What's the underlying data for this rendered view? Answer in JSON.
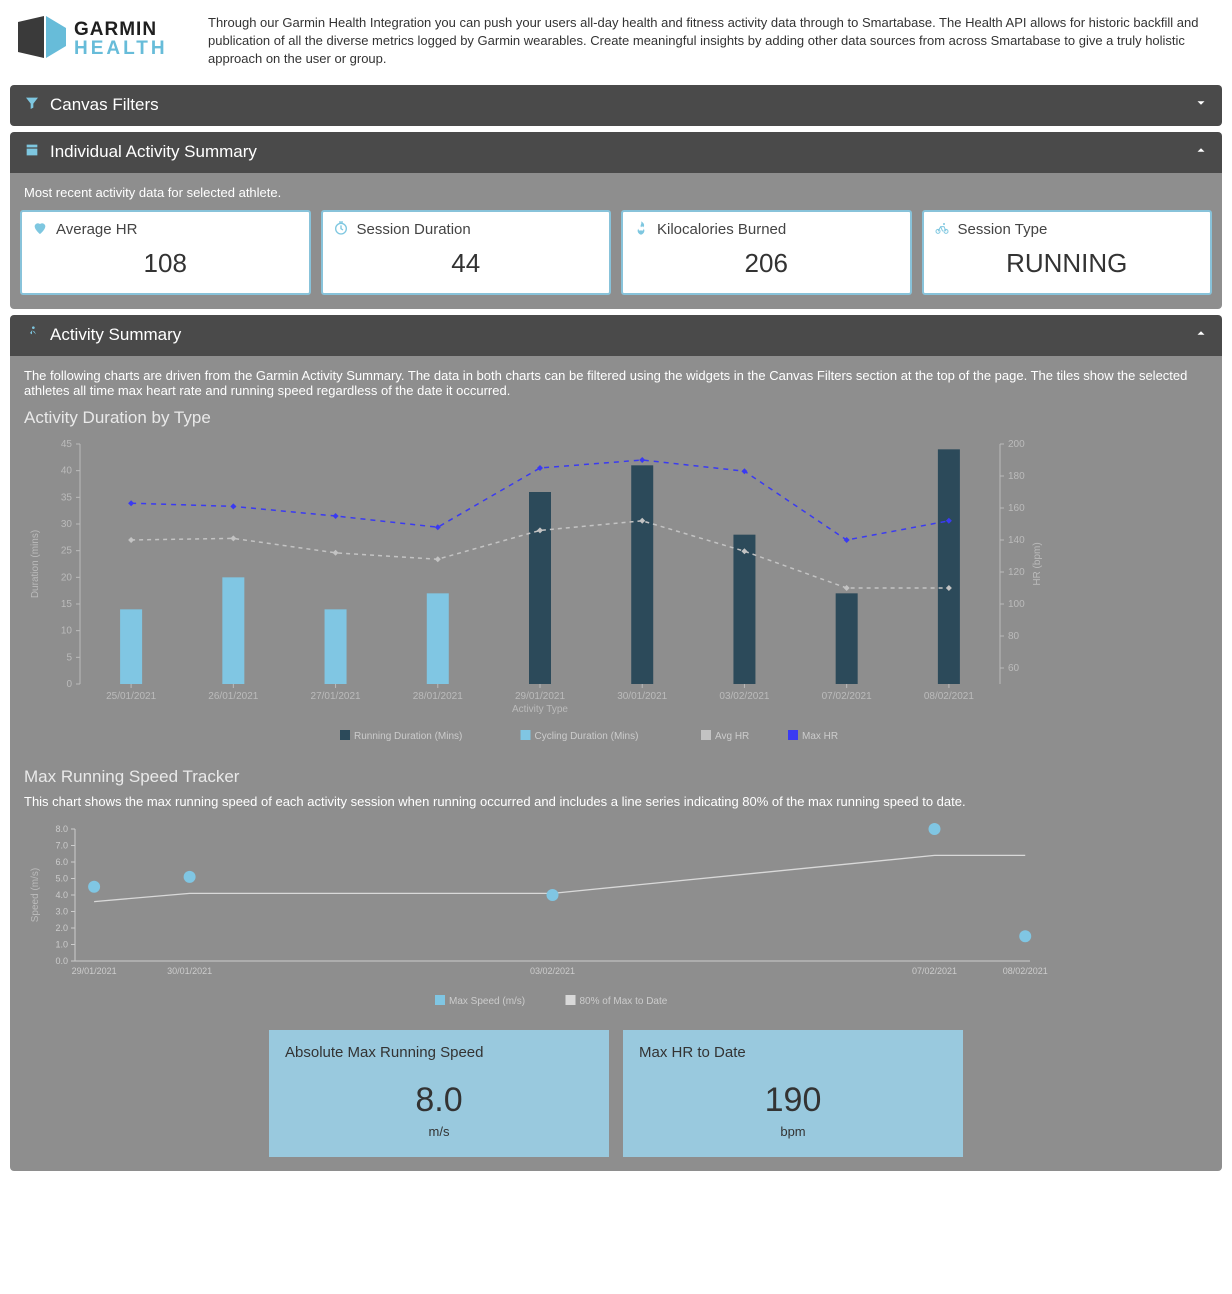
{
  "header": {
    "brand_top": "GARMIN",
    "brand_bottom": "HEALTH",
    "intro": "Through our Garmin Health Integration you can push your users all-day health and fitness activity data through to Smartabase. The Health API allows for historic backfill and publication of all the diverse metrics logged by Garmin wearables. Create meaningful insights by adding other data sources from across Smartabase to give a truly holistic approach on the user or group."
  },
  "filters": {
    "title": "Canvas Filters"
  },
  "individual": {
    "title": "Individual Activity Summary",
    "note": "Most recent activity data for selected athlete.",
    "tiles": [
      {
        "icon": "heart",
        "label": "Average HR",
        "value": "108"
      },
      {
        "icon": "clock",
        "label": "Session Duration",
        "value": "44"
      },
      {
        "icon": "fire",
        "label": "Kilocalories Burned",
        "value": "206"
      },
      {
        "icon": "bike",
        "label": "Session Type",
        "value": "RUNNING"
      }
    ]
  },
  "activity": {
    "title": "Activity Summary",
    "note": "The following charts are driven from the Garmin Activity Summary. The data in both charts can be filtered using the widgets in the Canvas Filters section at the top of the page. The tiles show the selected athletes all time max heart rate and running speed regardless of the date it occurred.",
    "chart1_title": "Activity Duration by Type",
    "chart2_title": "Max Running Speed Tracker",
    "chart2_note": "This chart shows the max running speed of each activity session when running occurred and includes a line series indicating 80% of the max running speed to date.",
    "legend1": [
      "Running Duration (Mins)",
      "Cycling Duration (Mins)",
      "Avg HR",
      "Max HR"
    ],
    "legend2": [
      "Max Speed (m/s)",
      "80% of Max to Date"
    ],
    "btiles": [
      {
        "title": "Absolute Max Running Speed",
        "value": "8.0",
        "unit": "m/s"
      },
      {
        "title": "Max HR to Date",
        "value": "190",
        "unit": "bpm"
      }
    ]
  },
  "chart_data": [
    {
      "type": "bar",
      "title": "Activity Duration by Type",
      "xlabel": "Activity Type",
      "ylabel": "Duration (mins)",
      "y2label": "HR (bpm)",
      "ylim": [
        0,
        45
      ],
      "y2lim": [
        50,
        200
      ],
      "categories": [
        "25/01/2021",
        "26/01/2021",
        "27/01/2021",
        "28/01/2021",
        "29/01/2021",
        "30/01/2021",
        "03/02/2021",
        "07/02/2021",
        "08/02/2021"
      ],
      "series": [
        {
          "name": "Running Duration (Mins)",
          "type": "bar",
          "values": [
            null,
            null,
            null,
            null,
            36,
            41,
            28,
            17,
            44
          ]
        },
        {
          "name": "Cycling Duration (Mins)",
          "type": "bar",
          "values": [
            14,
            20,
            14,
            17,
            null,
            null,
            null,
            null,
            null
          ]
        },
        {
          "name": "Avg HR",
          "type": "line",
          "axis": "y2",
          "values": [
            140,
            141,
            132,
            128,
            146,
            152,
            133,
            110,
            110
          ]
        },
        {
          "name": "Max HR",
          "type": "line",
          "axis": "y2",
          "values": [
            163,
            161,
            155,
            148,
            185,
            190,
            183,
            140,
            152
          ]
        }
      ],
      "legend_position": "bottom",
      "grid": false
    },
    {
      "type": "scatter",
      "title": "Max Running Speed Tracker",
      "xlabel": "",
      "ylabel": "Speed (m/s)",
      "ylim": [
        0,
        8
      ],
      "x_categories": [
        "29/01/2021",
        "30/01/2021",
        "03/02/2021",
        "07/02/2021",
        "08/02/2021"
      ],
      "series": [
        {
          "name": "Max Speed (m/s)",
          "type": "scatter",
          "x": [
            "29/01/2021",
            "30/01/2021",
            "03/02/2021",
            "07/02/2021",
            "08/02/2021"
          ],
          "y": [
            4.5,
            5.1,
            4.0,
            8.0,
            1.5
          ]
        },
        {
          "name": "80% of Max to Date",
          "type": "line",
          "x": [
            "29/01/2021",
            "30/01/2021",
            "03/02/2021",
            "07/02/2021",
            "08/02/2021"
          ],
          "y": [
            3.6,
            4.1,
            4.1,
            6.4,
            6.4
          ]
        }
      ],
      "x_tick_labels": [
        "29/01/2021",
        "30/01/2021",
        "03/02/2021",
        "07/02/2021",
        "08/02/2021"
      ],
      "legend_position": "bottom",
      "grid": false
    }
  ]
}
